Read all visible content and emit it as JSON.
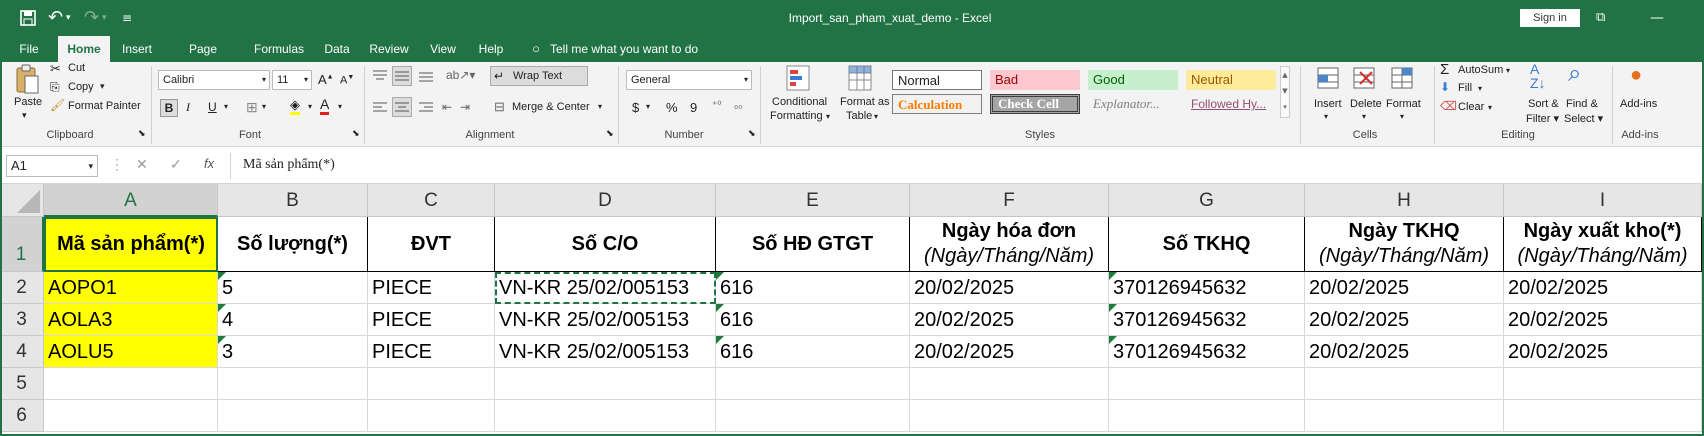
{
  "titlebar": {
    "title": "Import_san_pham_xuat_demo  -  Excel",
    "sign_in": "Sign in"
  },
  "tabs": [
    "File",
    "Home",
    "Insert",
    "Page Layout",
    "Formulas",
    "Data",
    "Review",
    "View",
    "Help"
  ],
  "tell_me": "Tell me what you want to do",
  "clipboard": {
    "paste": "Paste",
    "cut": "Cut",
    "copy": "Copy",
    "format_painter": "Format Painter",
    "label": "Clipboard"
  },
  "font": {
    "name": "Calibri",
    "size": "11",
    "label": "Font"
  },
  "alignment": {
    "wrap_text": "Wrap Text",
    "merge_center": "Merge & Center",
    "label": "Alignment"
  },
  "number": {
    "format": "General",
    "label": "Number",
    "currency": "$",
    "percent": "%",
    "comma": "9"
  },
  "styles": {
    "conditional": "Conditional",
    "formatting": "Formatting",
    "format_as": "Format as",
    "table": "Table",
    "normal": "Normal",
    "bad": "Bad",
    "good": "Good",
    "neutral": "Neutral",
    "calculation": "Calculation",
    "check_cell": "Check Cell",
    "explanatory": "Explanator...",
    "followed": "Followed Hy...",
    "label": "Styles"
  },
  "cells": {
    "insert": "Insert",
    "delete": "Delete",
    "format": "Format",
    "label": "Cells"
  },
  "editing": {
    "autosum": "AutoSum",
    "fill": "Fill",
    "clear": "Clear",
    "sort_filter": "Sort &",
    "filter": "Filter",
    "find_select": "Find &",
    "select": "Select",
    "label": "Editing"
  },
  "addins": {
    "btn": "Add-ins",
    "label": "Add-ins"
  },
  "formula_bar": {
    "name_box": "A1",
    "content": "Mã sản phẩm(*)"
  },
  "columns": [
    "A",
    "B",
    "C",
    "D",
    "E",
    "F",
    "G",
    "H",
    "I"
  ],
  "rows": [
    "1",
    "2",
    "3",
    "4",
    "5",
    "6"
  ],
  "header": {
    "a": "Mã sản phẩm(*)",
    "b": "Số lượng(*)",
    "c": "ĐVT",
    "d": "Số C/O",
    "e": "Số HĐ GTGT",
    "f": "Ngày hóa đơn",
    "f_sub": "(Ngày/Tháng/Năm)",
    "g": "Số TKHQ",
    "h": "Ngày TKHQ",
    "h_sub": "(Ngày/Tháng/Năm)",
    "i": "Ngày xuất kho(*)",
    "i_sub": "(Ngày/Tháng/Năm)"
  },
  "data": [
    [
      "AOPO1",
      "5",
      "PIECE",
      "VN-KR 25/02/005153",
      "616",
      "20/02/2025",
      "370126945632",
      "20/02/2025",
      "20/02/2025"
    ],
    [
      "AOLA3",
      "4",
      "PIECE",
      "VN-KR 25/02/005153",
      "616",
      "20/02/2025",
      "370126945632",
      "20/02/2025",
      "20/02/2025"
    ],
    [
      "AOLU5",
      "3",
      "PIECE",
      "VN-KR 25/02/005153",
      "616",
      "20/02/2025",
      "370126945632",
      "20/02/2025",
      "20/02/2025"
    ]
  ],
  "colors": {
    "excel_green": "#217346",
    "highlight_yellow": "#ffff00"
  }
}
